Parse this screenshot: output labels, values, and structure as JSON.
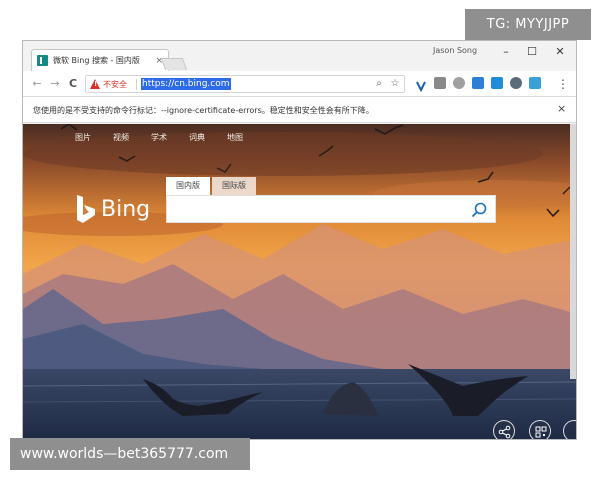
{
  "overlay": {
    "tg_badge": "TG: MYYJJPP",
    "site_watermark": "www.worlds—bet365777.com"
  },
  "browser": {
    "tab": {
      "title": "微软 Bing 搜索 - 国内版",
      "close": "×",
      "favicon": "bing-favicon"
    },
    "user_name": "Jason Song",
    "window_controls": {
      "minimize": "–",
      "maximize": "☐",
      "close": "✕"
    },
    "toolbar": {
      "back": "←",
      "forward": "→",
      "reload": "C",
      "insecure_label": "不安全",
      "url": "https://cn.bing.com",
      "zoom_icon": "⌕",
      "star_icon": "☆",
      "menu_icon": "⋮",
      "extension_icons": [
        "v-extension-icon",
        "qr-extension-icon",
        "puzzle-extension-icon",
        "user-extension-icon",
        "blue-extension-icon",
        "refresh-extension-icon",
        "green-extension-icon"
      ]
    },
    "infobar": {
      "text": "您使用的是不受支持的命令行标记：--ignore-certificate-errors。稳定性和安全性会有所下降。",
      "close": "×"
    }
  },
  "bing": {
    "nav": [
      "图片",
      "视频",
      "学术",
      "词典",
      "地图"
    ],
    "logo_text": "Bing",
    "search_tabs": {
      "domestic": "国内版",
      "international": "国际版"
    },
    "search_placeholder": "",
    "colors": {
      "accent": "#138a86",
      "search_icon": "#1a73b8"
    }
  }
}
